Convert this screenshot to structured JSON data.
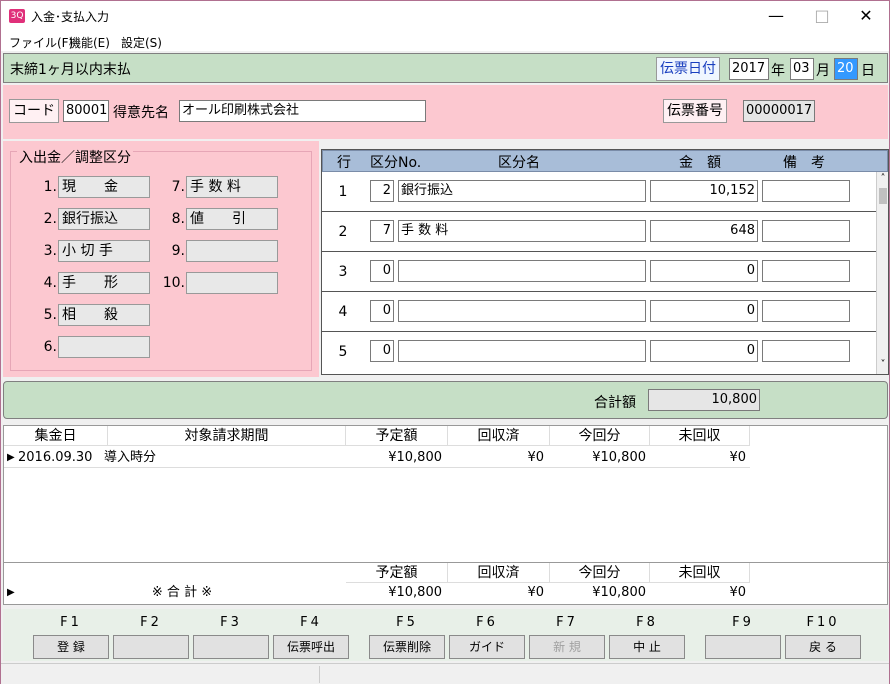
{
  "window": {
    "title": "入金･支払入力",
    "icon_text": "3Q",
    "minimize": "—",
    "maximize": "□",
    "close": "✕"
  },
  "menu": [
    "ファイル(F)",
    "機能(E)",
    "設定(S)"
  ],
  "header": {
    "mode": "末締1ヶ月以内末払",
    "date_label": "伝票日付",
    "year": "2017",
    "year_unit": "年",
    "month": "03",
    "month_unit": "月",
    "day": "20",
    "day_unit": "日"
  },
  "customer": {
    "code_label": "コード",
    "code": "80001",
    "name_label": "得意先名",
    "name": "オール印刷株式会社",
    "slip_label": "伝票番号",
    "slip_no": "00000017"
  },
  "categories": {
    "title": "入出金／調整区分",
    "items": [
      {
        "no": "1.",
        "label": "現　　金"
      },
      {
        "no": "2.",
        "label": "銀行振込"
      },
      {
        "no": "3.",
        "label": "小 切 手"
      },
      {
        "no": "4.",
        "label": "手　　形"
      },
      {
        "no": "5.",
        "label": "相　　殺"
      },
      {
        "no": "6.",
        "label": ""
      },
      {
        "no": "7.",
        "label": "手 数 料"
      },
      {
        "no": "8.",
        "label": "値　　引"
      },
      {
        "no": "9.",
        "label": ""
      },
      {
        "no": "10.",
        "label": ""
      }
    ]
  },
  "grid": {
    "headers": {
      "row": "行",
      "code": "区分No.",
      "name": "区分名",
      "amount": "金　額",
      "note": "備　考"
    },
    "rows": [
      {
        "no": "1",
        "code": "2",
        "name": "銀行振込",
        "amount": "10,152",
        "note": ""
      },
      {
        "no": "2",
        "code": "7",
        "name": "手 数 料",
        "amount": "648",
        "note": ""
      },
      {
        "no": "3",
        "code": "0",
        "name": "",
        "amount": "0",
        "note": ""
      },
      {
        "no": "4",
        "code": "0",
        "name": "",
        "amount": "0",
        "note": ""
      },
      {
        "no": "5",
        "code": "0",
        "name": "",
        "amount": "0",
        "note": ""
      }
    ],
    "scroll_up": "˄",
    "scroll_down": "˅"
  },
  "total": {
    "label": "合計額",
    "value": "10,800"
  },
  "collection": {
    "headers": [
      "集金日",
      "対象請求期間",
      "予定額",
      "回収済",
      "今回分",
      "未回収"
    ],
    "rows": [
      {
        "marker": "▶",
        "date": "2016.09.30",
        "period": "導入時分",
        "planned": "¥10,800",
        "collected": "¥0",
        "current": "¥10,800",
        "remaining": "¥0"
      }
    ],
    "summary_headers": [
      "予定額",
      "回収済",
      "今回分",
      "未回収"
    ],
    "summary": {
      "marker": "▶",
      "label": "※ 合 計 ※",
      "planned": "¥10,800",
      "collected": "¥0",
      "current": "¥10,800",
      "remaining": "¥0"
    }
  },
  "fkeys": [
    {
      "key": "F1",
      "label": "登 録",
      "enabled": true
    },
    {
      "key": "F2",
      "label": "",
      "enabled": true
    },
    {
      "key": "F3",
      "label": "",
      "enabled": true
    },
    {
      "key": "F4",
      "label": "伝票呼出",
      "enabled": true
    },
    {
      "key": "F5",
      "label": "伝票削除",
      "enabled": true
    },
    {
      "key": "F6",
      "label": "ガイド",
      "enabled": true
    },
    {
      "key": "F7",
      "label": "新 規",
      "enabled": false
    },
    {
      "key": "F8",
      "label": "中 止",
      "enabled": true
    },
    {
      "key": "F9",
      "label": "",
      "enabled": true
    },
    {
      "key": "F10",
      "label": "戻 る",
      "enabled": true
    }
  ],
  "colors": {
    "green": "#c6dfc6",
    "pink": "#fcc8d0",
    "grid_header": "#a8bdd8",
    "date_label": "#1a3fbf",
    "day_highlight": "#3399ff"
  }
}
